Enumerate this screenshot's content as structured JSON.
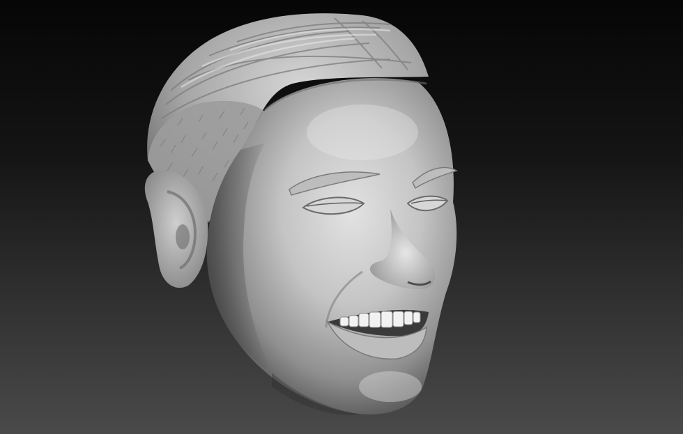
{
  "scene": {
    "colors": {
      "background_top": "#060606",
      "background_bottom": "#4a4a4a",
      "clay_light": "#d8d8d8",
      "clay_mid": "#a9a9a9",
      "clay_shadow": "#5c5c5c",
      "teeth": "#f2f2f2"
    }
  }
}
